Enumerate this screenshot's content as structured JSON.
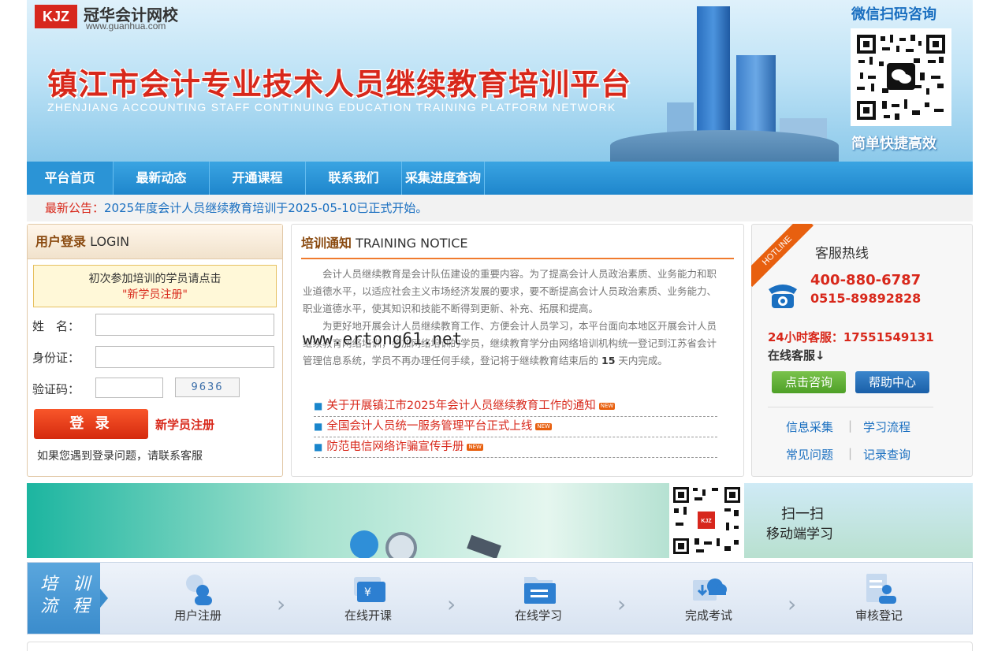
{
  "header": {
    "logo_badge": "KJZ",
    "logo_name": "冠华会计网校",
    "logo_url": "www.guanhua.com",
    "main_title": "镇江市会计专业技术人员继续教育培训平台",
    "sub_title": "ZHENJIANG ACCOUNTING STAFF CONTINUING EDUCATION TRAINING PLATFORM NETWORK",
    "wechat_title": "微信扫码咨询",
    "wechat_footer": "简单快捷高效"
  },
  "nav": {
    "items": [
      "平台首页",
      "最新动态",
      "开通课程",
      "联系我们",
      "采集进度查询"
    ]
  },
  "notice": {
    "label": "最新公告：",
    "text": "2025年度会计人员继续教育培训于2025-05-10已正式开始。"
  },
  "login": {
    "title_cn": "用户登录",
    "title_en": "LOGIN",
    "first_line": "初次参加培训的学员请点击",
    "first_reg": "\"新学员注册\"",
    "name_label": "姓　名：",
    "id_label": "身份证：",
    "captcha_label": "验证码：",
    "captcha_code": "9636",
    "login_button": "登 录",
    "register_link": "新学员注册",
    "help_text": "如果您遇到登录问题，请联系客服"
  },
  "training": {
    "title_cn": "培训通知",
    "title_en": "TRAINING NOTICE",
    "para1": "会计人员继续教育是会计队伍建设的重要内容。为了提高会计人员政治素质、业务能力和职业道德水平，以适应社会主义市场经济发展的要求，要不断提高会计人员政治素质、业务能力、职业道德水平，使其知识和技能不断得到更新、补充、拓展和提高。",
    "para2_a": "为更好地开展会计人员继续教育工作、方便会计人员学习，本平台面向本地区开展会计人员继续教育网络培训，参加网络培训的学员，继续教育学分由网络培训机构统一登记到江苏省会计管理信息系统，学员不再办理任何手续，登记将于继续教育结束后的",
    "para2_num": "15",
    "para2_b": "天内完成。",
    "watermark": "www.ertong61.net",
    "links": [
      "关于开展镇江市2025年会计人员继续教育工作的通知",
      "全国会计人员统一服务管理平台正式上线",
      "防范电信网络诈骗宣传手册"
    ],
    "new_tag": "NEW"
  },
  "service": {
    "ribbon": "HOTLINE",
    "title": "客服热线",
    "tel1": "400-880-6787",
    "tel2": "0515-89892828",
    "hotline_24": "24小时客服：17551549131",
    "online": "在线客服↓",
    "consult_button": "点击咨询",
    "help_button": "帮助中心",
    "links": [
      "信息采集",
      "学习流程",
      "常见问题",
      "记录查询"
    ],
    "separator": "|"
  },
  "banner": {
    "scan_line1": "扫一扫",
    "scan_line2": "移动端学习"
  },
  "process": {
    "label_line1": "培 训",
    "label_line2": "流 程",
    "steps": [
      "用户注册",
      "在线开课",
      "在线学习",
      "完成考试",
      "审核登记"
    ],
    "chevron": "›"
  },
  "colors": {
    "brand_red": "#d8281b",
    "nav_blue": "#1e86cc",
    "link_blue": "#1a6fc0",
    "accent_orange": "#e8600f"
  }
}
